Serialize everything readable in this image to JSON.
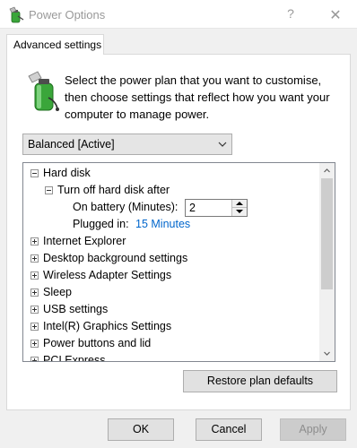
{
  "window": {
    "title": "Power Options",
    "help_glyph": "?",
    "close_glyph": "✕"
  },
  "tabs": [
    {
      "label": "Advanced settings",
      "selected": true
    }
  ],
  "intro_text": "Select the power plan that you want to customise, then choose settings that reflect how you want your computer to manage power.",
  "plan_select": {
    "value": "Balanced [Active]"
  },
  "tree": {
    "items": [
      {
        "label": "Hard disk",
        "expanded": true
      },
      {
        "label": "Turn off hard disk after",
        "expanded": true
      },
      {
        "label": "On battery (Minutes):",
        "value": "2"
      },
      {
        "label": "Plugged in:",
        "value": "15 Minutes"
      },
      {
        "label": "Internet Explorer",
        "expanded": false
      },
      {
        "label": "Desktop background settings",
        "expanded": false
      },
      {
        "label": "Wireless Adapter Settings",
        "expanded": false
      },
      {
        "label": "Sleep",
        "expanded": false
      },
      {
        "label": "USB settings",
        "expanded": false
      },
      {
        "label": "Intel(R) Graphics Settings",
        "expanded": false
      },
      {
        "label": "Power buttons and lid",
        "expanded": false
      },
      {
        "label": "PCI Express",
        "expanded": false
      }
    ]
  },
  "buttons": {
    "restore": "Restore plan defaults",
    "ok": "OK",
    "cancel": "Cancel",
    "apply": "Apply"
  },
  "colors": {
    "link": "#0066cc",
    "battery_green": "#3aa63a"
  }
}
